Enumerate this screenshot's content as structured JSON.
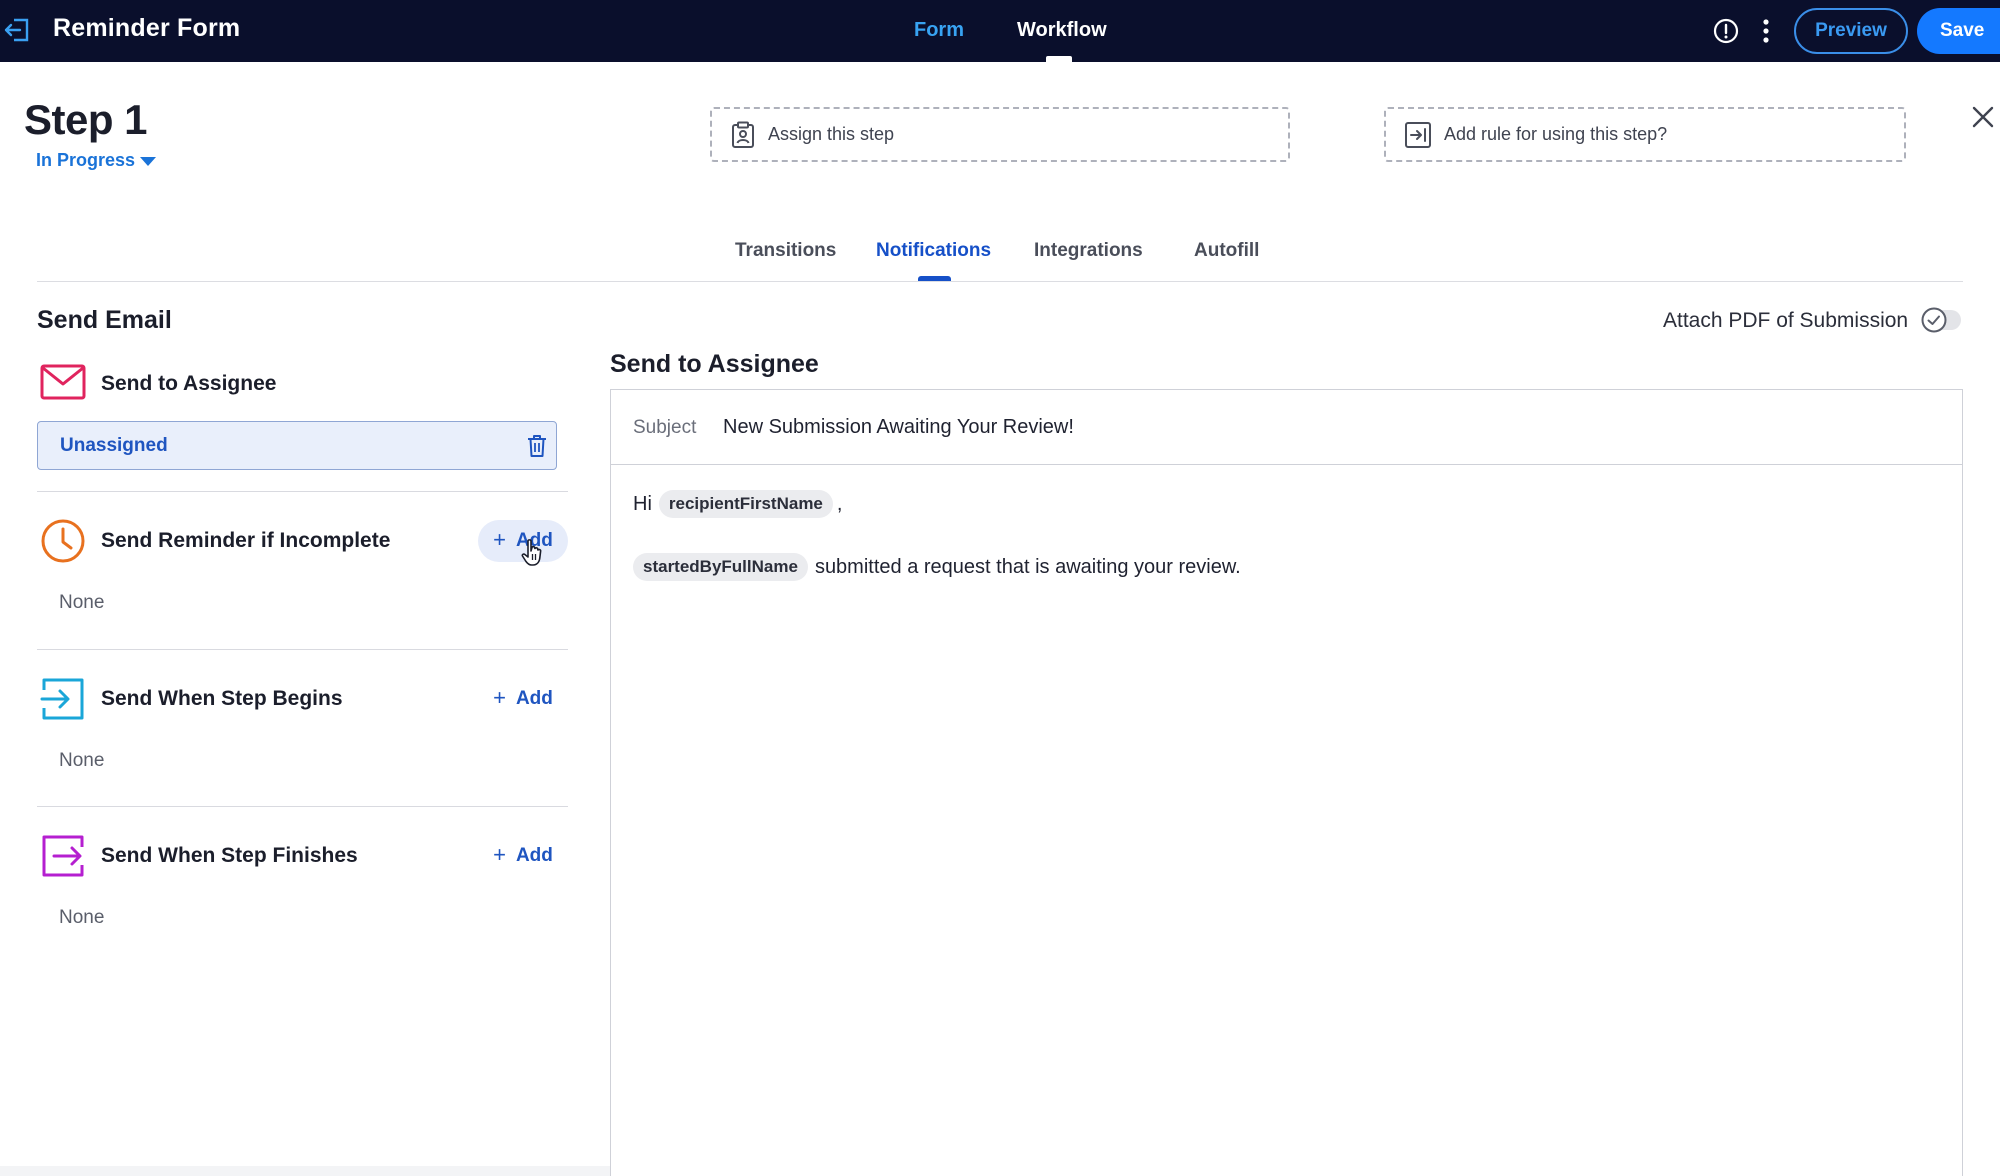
{
  "app": {
    "title": "Reminder Form",
    "tabs": [
      {
        "label": "Form",
        "active": false
      },
      {
        "label": "Workflow",
        "active": true
      }
    ],
    "preview_label": "Preview",
    "save_label": "Save"
  },
  "step": {
    "title": "Step 1",
    "status": "In Progress",
    "assign_label": "Assign this step",
    "rule_label": "Add rule for using this step?"
  },
  "tabs": [
    {
      "label": "Transitions"
    },
    {
      "label": "Notifications"
    },
    {
      "label": "Integrations"
    },
    {
      "label": "Autofill"
    }
  ],
  "active_tab": "Notifications",
  "left_panel": {
    "section_title": "Send Email",
    "assignee": {
      "title": "Send to Assignee",
      "value": "Unassigned"
    },
    "reminder": {
      "title": "Send Reminder if Incomplete",
      "add_label": "Add",
      "value": "None"
    },
    "begins": {
      "title": "Send When Step Begins",
      "add_label": "Add",
      "value": "None"
    },
    "finishes": {
      "title": "Send When Step Finishes",
      "add_label": "Add",
      "value": "None"
    }
  },
  "right_panel": {
    "attach_label": "Attach PDF of Submission",
    "attach_enabled": false,
    "email_title": "Send to Assignee",
    "subject_label": "Subject",
    "subject_value": "New Submission Awaiting Your Review!",
    "greeting": "Hi",
    "greeting_chip": "recipientFirstName",
    "greeting_suffix": ",",
    "body_chip": "startedByFullName",
    "body_text": "submitted a request that is awaiting your review."
  },
  "colors": {
    "topbar": "#0a0f2c",
    "accent": "#1479ff",
    "link": "#1f55c0",
    "mail_icon": "#e0245e",
    "clock_icon": "#e8711f",
    "begin_icon": "#1aa6d8",
    "finish_icon": "#b51fd0"
  }
}
